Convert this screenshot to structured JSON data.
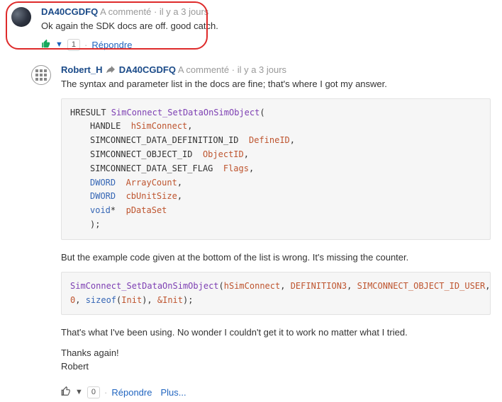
{
  "comment1": {
    "author": "DA40CGDFQ",
    "action": "A commenté",
    "time": "il y a 3 jours",
    "body": "Ok again the SDK docs are off. good catch.",
    "vote_count": "1",
    "reply_label": "Répondre"
  },
  "comment2": {
    "author": "Robert_H",
    "reply_to": "DA40CGDFQ",
    "action": "A commenté",
    "time": "il y a 3 jours",
    "intro": "The syntax and parameter list in the docs are fine; that's where I got my answer.",
    "code1": {
      "l0a": "HRESULT ",
      "l0b": "SimConnect_SetDataOnSimObject",
      "l0c": "(",
      "l1a": "HANDLE  ",
      "l1b": "hSimConnect",
      "l1c": ",",
      "l2a": "SIMCONNECT_DATA_DEFINITION_ID  ",
      "l2b": "DefineID",
      "l2c": ",",
      "l3a": "SIMCONNECT_OBJECT_ID  ",
      "l3b": "ObjectID",
      "l3c": ",",
      "l4a": "SIMCONNECT_DATA_SET_FLAG  ",
      "l4b": "Flags",
      "l4c": ",",
      "l5a": "DWORD  ",
      "l5b": "ArrayCount",
      "l5c": ",",
      "l6a": "DWORD  ",
      "l6b": "cbUnitSize",
      "l6c": ",",
      "l7a": "void",
      "l7a2": "*  ",
      "l7b": "pDataSet",
      "l8": ");"
    },
    "mid": "But the example code given at the bottom of the list is wrong. It's missing the counter.",
    "code2": {
      "fn": "SimConnect_SetDataOnSimObject",
      "open": "(",
      "p1": "hSimConnect",
      "c1": ", ",
      "p2": "DEFINITION3",
      "c2": ", ",
      "p3": "SIMCONNECT_OBJECT_ID_USER",
      "c3": ",",
      "zero": "0",
      "c4": ", ",
      "sizeof": "sizeof",
      "sp": "(",
      "init1": "Init",
      "spc": "), ",
      "amp": "&",
      "init2": "Init",
      "close": ");"
    },
    "outro1": "That's what I've been using. No wonder I couldn't get it to work no matter what I tried.",
    "outro2": "Thanks again!",
    "outro3": "Robert",
    "vote_count": "0",
    "reply_label": "Répondre",
    "more_label": "Plus..."
  },
  "separator": " · "
}
